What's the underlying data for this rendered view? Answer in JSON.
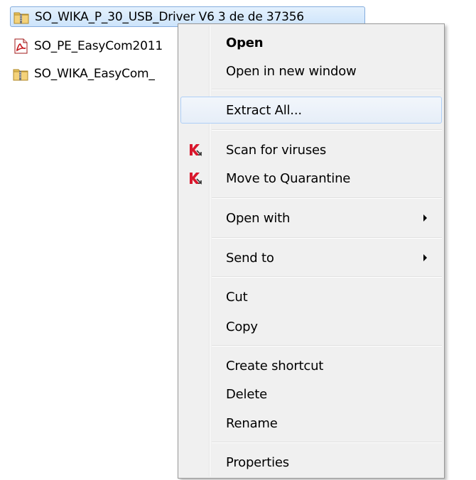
{
  "files": [
    {
      "name": "SO_WIKA_P_30_USB_Driver V6 3 de de 37356",
      "icon": "zip-folder-icon",
      "selected": true
    },
    {
      "name": "SO_PE_EasyCom2011",
      "icon": "pdf-icon",
      "selected": false
    },
    {
      "name": "SO_WIKA_EasyCom_",
      "icon": "zip-folder-icon",
      "selected": false
    }
  ],
  "menu": {
    "open": "Open",
    "open_new_window": "Open in new window",
    "extract_all": "Extract All...",
    "scan_viruses": "Scan for viruses",
    "move_quarantine": "Move to Quarantine",
    "open_with": "Open with",
    "send_to": "Send to",
    "cut": "Cut",
    "copy": "Copy",
    "create_shortcut": "Create shortcut",
    "delete": "Delete",
    "rename": "Rename",
    "properties": "Properties"
  },
  "colors": {
    "selection_border": "#84acdd",
    "hover_border": "#aecff7",
    "kaspersky_red": "#d9182d"
  }
}
